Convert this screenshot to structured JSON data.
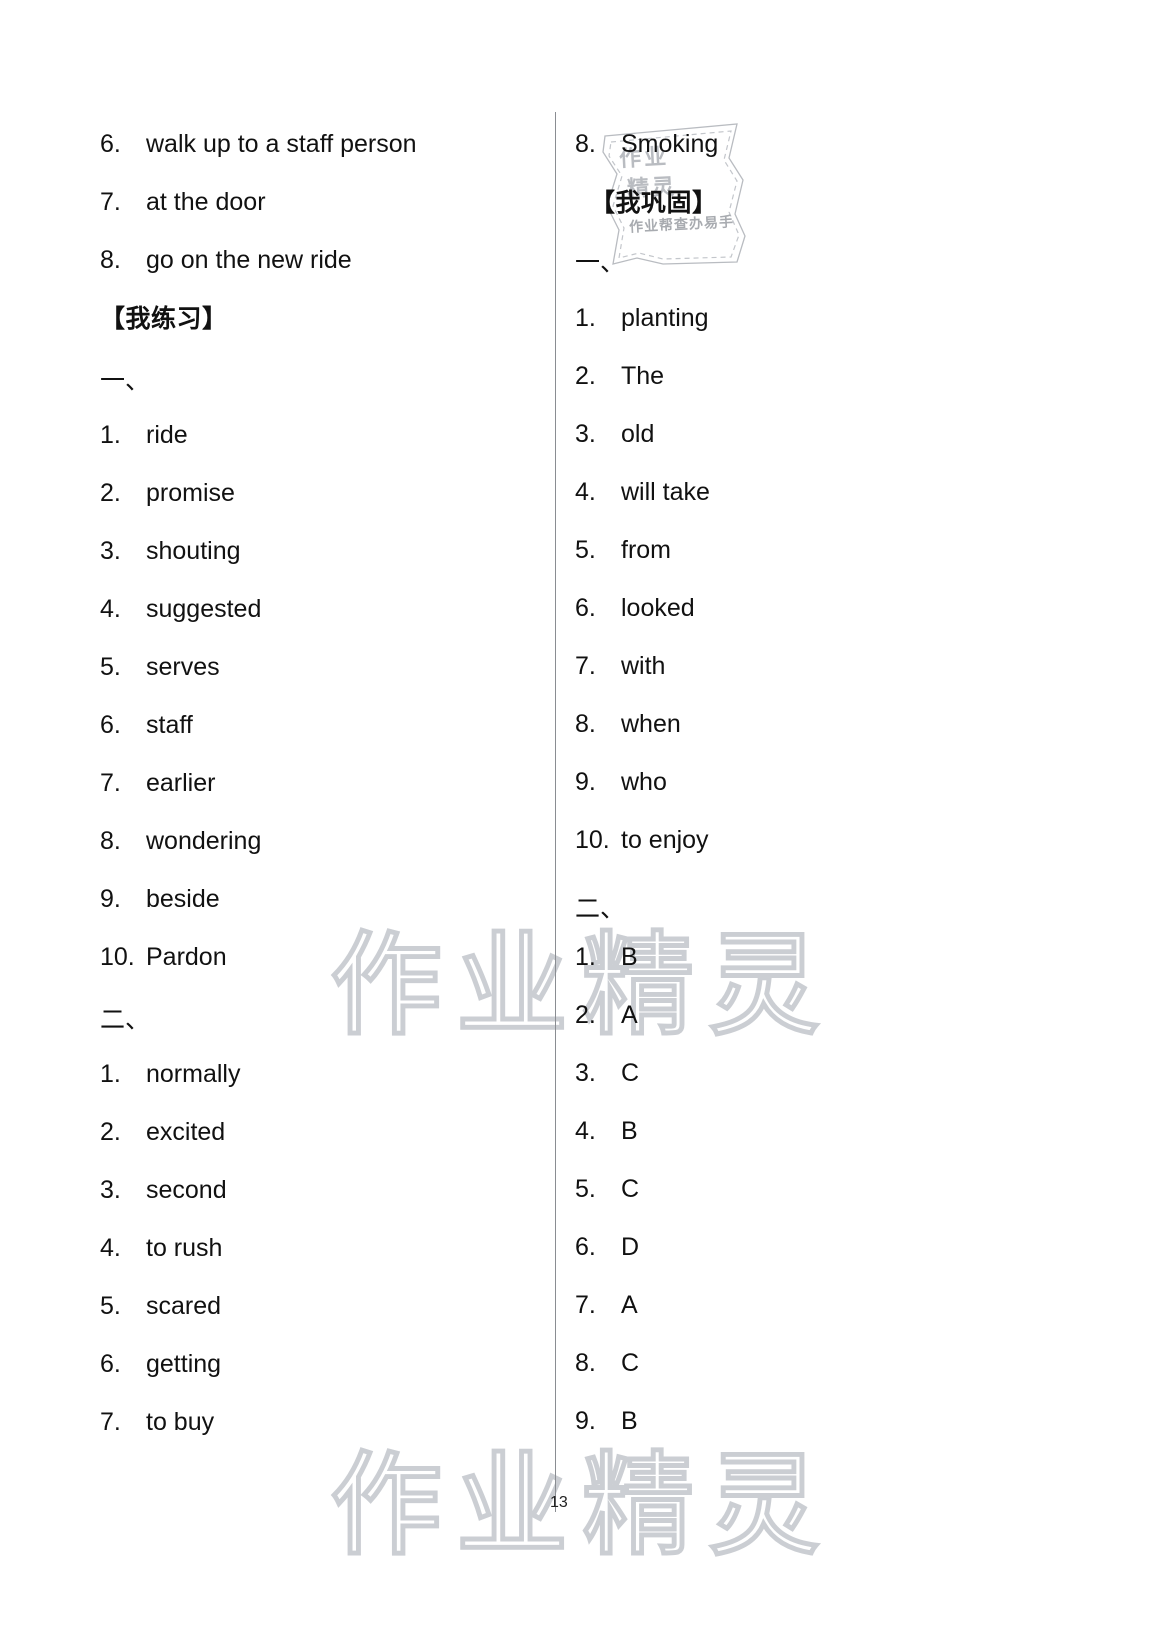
{
  "page": {
    "number": "13",
    "divider_color": "#8a8d92",
    "watermark_text": "作业精灵",
    "background": "#ffffff"
  },
  "stamp": {
    "line1": "作业",
    "line2": "精灵",
    "line3": "作业帮查办易手",
    "color": "#b9bcc1"
  },
  "left_column": {
    "carryover_items": [
      {
        "num": "6.",
        "text": "walk up to a staff person"
      },
      {
        "num": "7.",
        "text": "at the door"
      },
      {
        "num": "8.",
        "text": "go on the new ride"
      }
    ],
    "heading": "【我练习】",
    "section_one": {
      "label": "一、",
      "items": [
        {
          "num": "1.",
          "text": "ride"
        },
        {
          "num": "2.",
          "text": "promise"
        },
        {
          "num": "3.",
          "text": "shouting"
        },
        {
          "num": "4.",
          "text": "suggested"
        },
        {
          "num": "5.",
          "text": "serves"
        },
        {
          "num": "6.",
          "text": "staff"
        },
        {
          "num": "7.",
          "text": "earlier"
        },
        {
          "num": "8.",
          "text": "wondering"
        },
        {
          "num": "9.",
          "text": "beside"
        },
        {
          "num": "10.",
          "text": "Pardon"
        }
      ]
    },
    "section_two": {
      "label": "二、",
      "items": [
        {
          "num": "1.",
          "text": "normally"
        },
        {
          "num": "2.",
          "text": "excited"
        },
        {
          "num": "3.",
          "text": "second"
        },
        {
          "num": "4.",
          "text": "to rush"
        },
        {
          "num": "5.",
          "text": "scared"
        },
        {
          "num": "6.",
          "text": "getting"
        },
        {
          "num": "7.",
          "text": "to buy"
        }
      ]
    }
  },
  "right_column": {
    "carryover_items": [
      {
        "num": "8.",
        "text": "Smoking"
      }
    ],
    "heading": "【我巩固】",
    "section_one": {
      "label": "一、",
      "items": [
        {
          "num": "1.",
          "text": "planting"
        },
        {
          "num": "2.",
          "text": "The"
        },
        {
          "num": "3.",
          "text": "old"
        },
        {
          "num": "4.",
          "text": "will take"
        },
        {
          "num": "5.",
          "text": "from"
        },
        {
          "num": "6.",
          "text": "looked"
        },
        {
          "num": "7.",
          "text": "with"
        },
        {
          "num": "8.",
          "text": "when"
        },
        {
          "num": "9.",
          "text": "who"
        },
        {
          "num": "10.",
          "text": "to enjoy"
        }
      ]
    },
    "section_two": {
      "label": "二、",
      "items": [
        {
          "num": "1.",
          "text": "B"
        },
        {
          "num": "2.",
          "text": "A"
        },
        {
          "num": "3.",
          "text": "C"
        },
        {
          "num": "4.",
          "text": "B"
        },
        {
          "num": "5.",
          "text": "C"
        },
        {
          "num": "6.",
          "text": "D"
        },
        {
          "num": "7.",
          "text": "A"
        },
        {
          "num": "8.",
          "text": "C"
        },
        {
          "num": "9.",
          "text": "B"
        }
      ]
    }
  }
}
